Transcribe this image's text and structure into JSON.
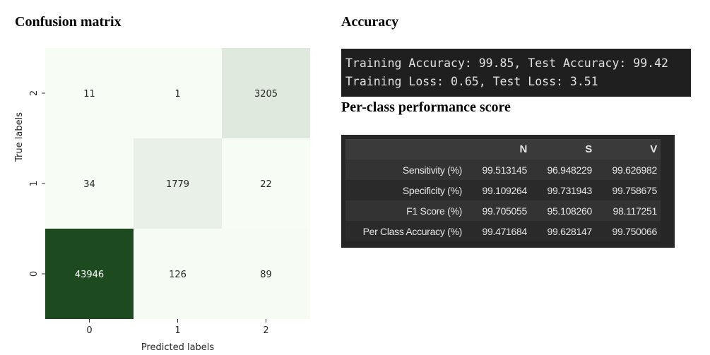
{
  "headings": {
    "confusion_matrix": "Confusion matrix",
    "accuracy": "Accuracy",
    "per_class": "Per-class performance score"
  },
  "accuracy_output": {
    "line1": "Training Accuracy: 99.85, Test Accuracy: 99.42",
    "line2": "Training Loss: 0.65, Test Loss: 3.51"
  },
  "per_class_table": {
    "columns": [
      "",
      "N",
      "S",
      "V"
    ],
    "rows": [
      {
        "label": "Sensitivity (%)",
        "values": [
          "99.513145",
          "96.948229",
          "99.626982"
        ]
      },
      {
        "label": "Specificity (%)",
        "values": [
          "99.109264",
          "99.731943",
          "99.758675"
        ]
      },
      {
        "label": "F1 Score (%)",
        "values": [
          "99.705055",
          "95.108260",
          "98.117251"
        ]
      },
      {
        "label": "Per Class Accuracy (%)",
        "values": [
          "99.471684",
          "99.628147",
          "99.750066"
        ]
      }
    ]
  },
  "chart_data": {
    "type": "heatmap",
    "title": "Confusion matrix",
    "xlabel": "Predicted labels",
    "ylabel": "True labels",
    "x_ticks": [
      "0",
      "1",
      "2"
    ],
    "y_ticks": [
      "2",
      "1",
      "0"
    ],
    "matrix": [
      [
        11,
        1,
        3205
      ],
      [
        34,
        1779,
        22
      ],
      [
        43946,
        126,
        89
      ]
    ],
    "colormap": "Greens",
    "colorbar": false,
    "colors": {
      "low": "#f7fcf5",
      "high": "#1e4a1f"
    }
  }
}
